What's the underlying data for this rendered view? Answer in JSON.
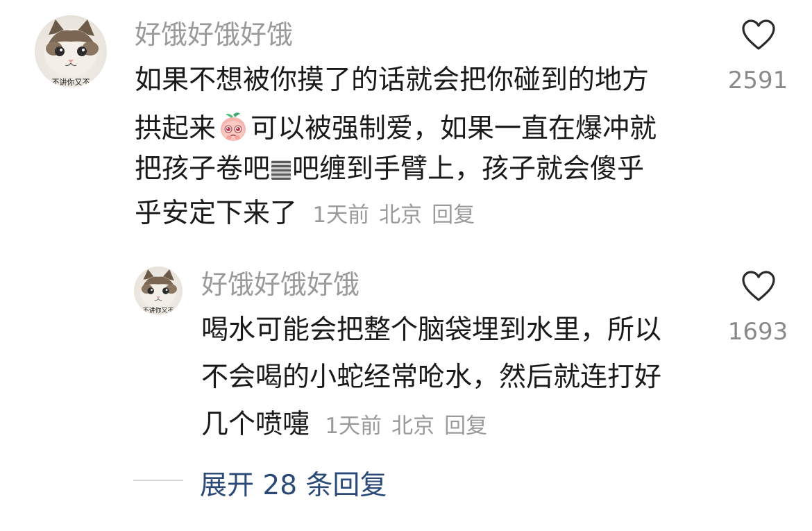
{
  "comment": {
    "username": "好饿好饿好饿",
    "avatar_caption": "不讲你又不",
    "lines": [
      "如果不想被你摸了的话就会把你碰到的地方",
      "拱起来",
      "可以被强制爱，如果一直在爆冲就",
      "把孩子卷吧",
      "吧缠到手臂上，孩子就会傻乎",
      "乎安定下来了"
    ],
    "time": "1天前",
    "location": "北京",
    "reply_label": "回复",
    "like_count": "2591",
    "emoji": "peach-pleading-emoji"
  },
  "reply": {
    "username": "好饿好饿好饿",
    "avatar_caption": "不讲你又不",
    "lines": [
      "喝水可能会把整个脑袋埋到水里，所以",
      "不会喝的小蛇经常呛水，然后就连打好",
      "几个喷嚏"
    ],
    "time": "1天前",
    "location": "北京",
    "reply_label": "回复",
    "like_count": "1693"
  },
  "expand": {
    "label": "展开 28 条回复"
  },
  "colors": {
    "username": "#9a9a9a",
    "body": "#1a1a1a",
    "meta": "#9a9a9a",
    "expand": "#2c4a78"
  },
  "icons": [
    "heart-outline-icon"
  ]
}
